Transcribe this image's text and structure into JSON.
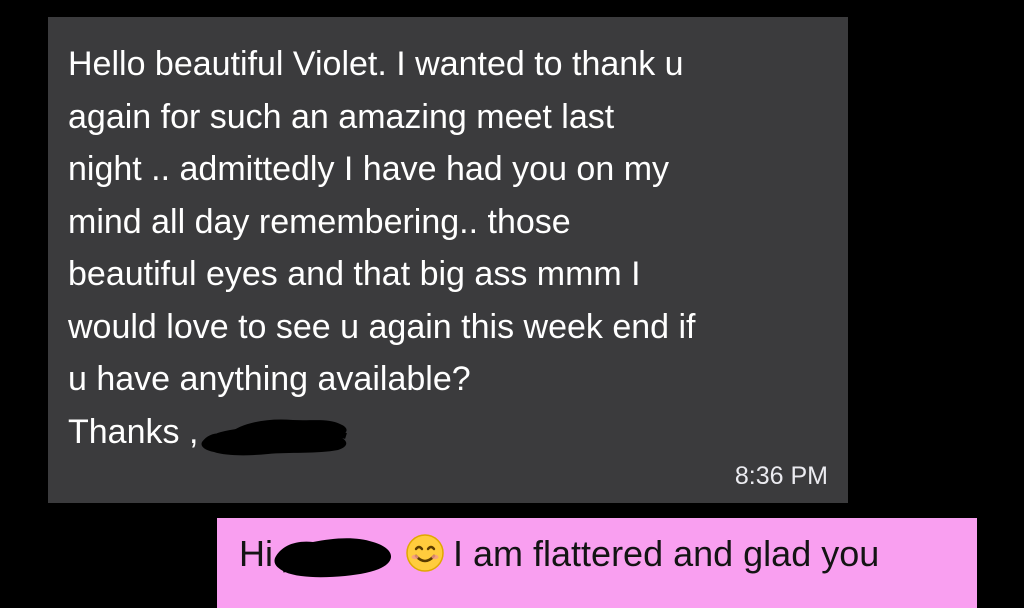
{
  "incoming_message": {
    "lines": [
      "Hello beautiful Violet. I wanted to thank u",
      "again for such an amazing meet last",
      "night .. admittedly I have had you on my",
      "mind all day remembering.. those",
      "beautiful eyes and that big ass mmm I",
      "would love to see u again this week end if",
      "u have anything available?",
      "Thanks ,"
    ],
    "timestamp": "8:36 PM"
  },
  "outgoing_message": {
    "greeting": "Hi",
    "emoji": "smiling-face-icon",
    "text": "I am flattered and glad you"
  },
  "colors": {
    "background": "#000000",
    "incoming_bubble": "#3b3b3d",
    "outgoing_bubble": "#f99ff0",
    "redaction": "#000000"
  }
}
